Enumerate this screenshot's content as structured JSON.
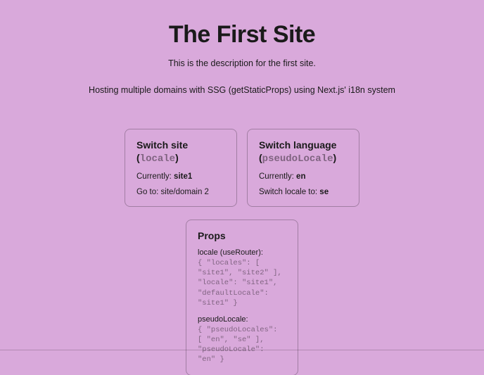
{
  "header": {
    "title": "The First Site",
    "description": "This is the description for the first site.",
    "subtitle": "Hosting multiple domains with SSG (getStaticProps) using Next.js' i18n system"
  },
  "siteCard": {
    "heading_prefix": "Switch site (",
    "heading_code": "locale",
    "heading_suffix": ")",
    "currently_label": "Currently: ",
    "currently_value": "site1",
    "goto_label": "Go to: ",
    "goto_value": "site/domain 2"
  },
  "langCard": {
    "heading_prefix": "Switch language (",
    "heading_code": "pseudoLocale",
    "heading_suffix": ")",
    "currently_label": "Currently: ",
    "currently_value": "en",
    "switch_label": "Switch locale to: ",
    "switch_value": "se"
  },
  "propsCard": {
    "heading": "Props",
    "locale_label": "locale (useRouter): ",
    "locale_json": "{ \"locales\": [ \"site1\", \"site2\" ], \"locale\": \"site1\", \"defaultLocale\": \"site1\" }",
    "pseudo_label": "pseudoLocale: ",
    "pseudo_json": "{ \"pseudoLocales\": [ \"en\", \"se\" ], \"pseudoLocale\": \"en\" }"
  }
}
